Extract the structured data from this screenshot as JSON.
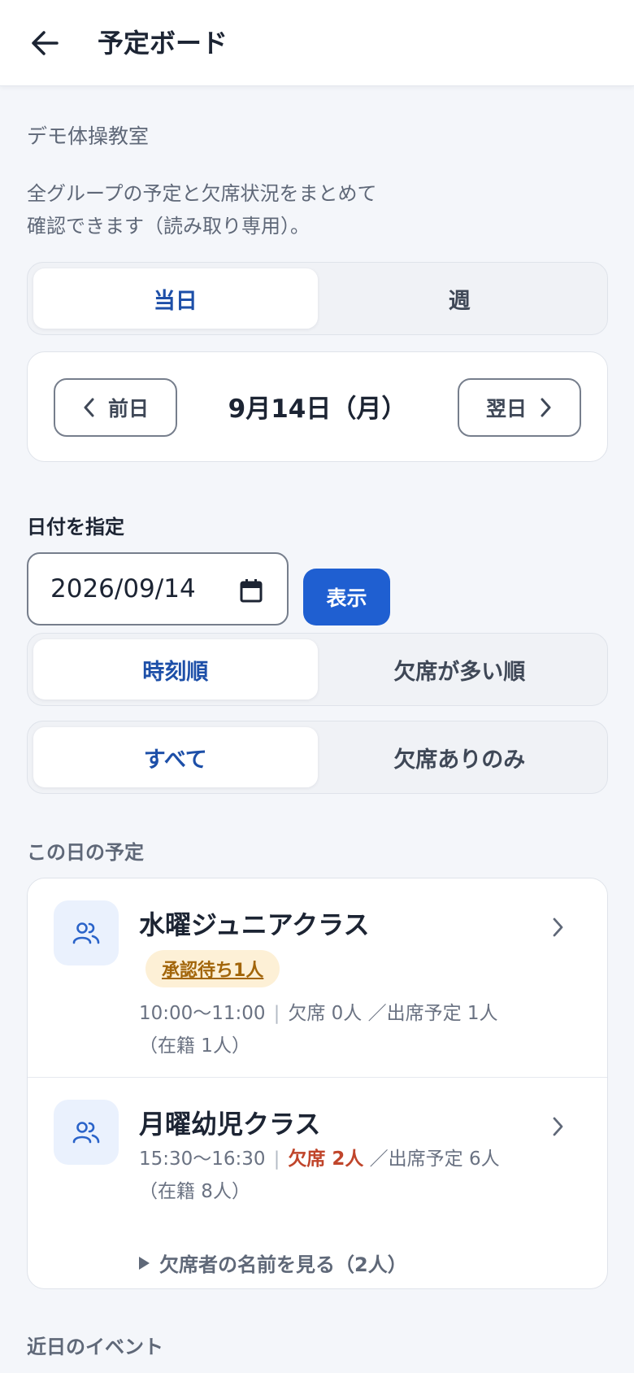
{
  "header": {
    "title": "予定ボード"
  },
  "school_name": "デモ体操教室",
  "description": {
    "line1": "全グループの予定と欠席状況をまとめて",
    "line2": "確認できます（読み取り専用）。"
  },
  "view_toggle": {
    "options": [
      "当日",
      "週"
    ],
    "selected": "当日"
  },
  "date_nav": {
    "prev_label": "前日",
    "current_date": "9月14日（月）",
    "next_label": "翌日"
  },
  "date_picker": {
    "label": "日付を指定",
    "value": "2026/09/14",
    "show_button": "表示"
  },
  "sort_toggle": {
    "options": [
      "時刻順",
      "欠席が多い順"
    ],
    "selected": "時刻順"
  },
  "filter_toggle": {
    "options": [
      "すべて",
      "欠席ありのみ"
    ],
    "selected": "すべて"
  },
  "schedule": {
    "heading": "この日の予定",
    "items": [
      {
        "name": "水曜ジュニアクラス",
        "badge": "承認待ち1人",
        "time": "10:00〜11:00",
        "sep": "|",
        "absent": "欠席 0人",
        "planned": "／出席予定 1人",
        "enrolled": "（在籍 1人）"
      },
      {
        "name": "月曜幼児クラス",
        "time": "15:30〜16:30",
        "sep": "|",
        "absent": "欠席 2人",
        "planned": "／出席予定 6人",
        "enrolled": "（在籍 8人）",
        "toggle": "欠席者の名前を見る（2人）"
      }
    ]
  },
  "events": {
    "heading": "近日のイベント"
  },
  "colors": {
    "accent": "#1f5fd1",
    "active_text": "#1d4fa8",
    "absent": "#c0452b",
    "badge_bg": "#fdf0d6",
    "badge_text": "#a2650a"
  }
}
